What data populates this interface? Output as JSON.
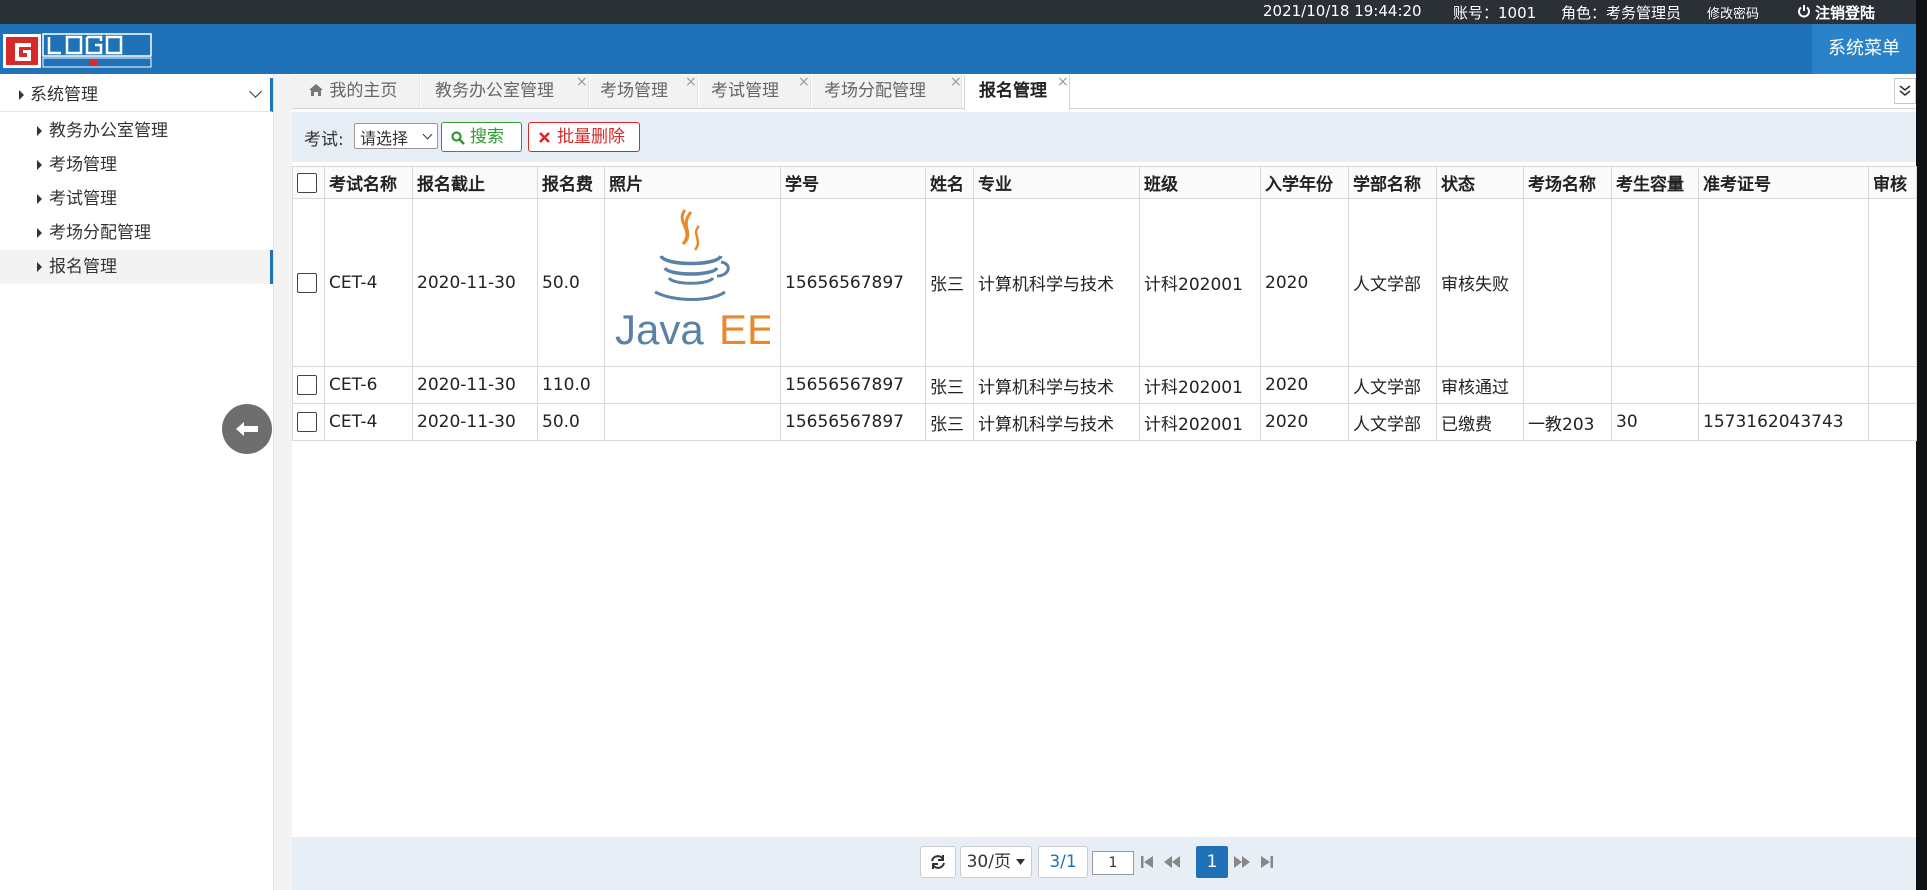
{
  "topbar": {
    "datetime": "2021/10/18 19:44:20",
    "account": "账号：1001",
    "role": "角色：考务管理员",
    "change_password": "修改密码",
    "logout": "注销登陆"
  },
  "header": {
    "system_menu": "系统菜单"
  },
  "sidebar": {
    "parent": "系统管理",
    "items": [
      "教务办公室管理",
      "考场管理",
      "考试管理",
      "考场分配管理",
      "报名管理"
    ]
  },
  "tabs": [
    {
      "label": "我的主页"
    },
    {
      "label": "教务办公室管理"
    },
    {
      "label": "考场管理"
    },
    {
      "label": "考试管理"
    },
    {
      "label": "考场分配管理"
    },
    {
      "label": "报名管理"
    }
  ],
  "toolbar": {
    "exam_label": "考试:",
    "exam_select": "请选择",
    "search_label": "搜索",
    "batch_delete_label": "批量删除"
  },
  "table": {
    "headers": [
      "考试名称",
      "报名截止",
      "报名费",
      "照片",
      "学号",
      "姓名",
      "专业",
      "班级",
      "入学年份",
      "学部名称",
      "状态",
      "考场名称",
      "考生容量",
      "准考证号",
      "审核"
    ],
    "rows": [
      [
        "CET-4",
        "2020-11-30",
        "50.0",
        "",
        "15656567897",
        "张三",
        "计算机科学与技术",
        "计科202001",
        "2020",
        "人文学部",
        "审核失败",
        "",
        "",
        "",
        ""
      ],
      [
        "CET-6",
        "2020-11-30",
        "110.0",
        "",
        "15656567897",
        "张三",
        "计算机科学与技术",
        "计科202001",
        "2020",
        "人文学部",
        "审核通过",
        "",
        "",
        "",
        ""
      ],
      [
        "CET-4",
        "2020-11-30",
        "50.0",
        "",
        "15656567897",
        "张三",
        "计算机科学与技术",
        "计科202001",
        "2020",
        "人文学部",
        "已缴费",
        "一教203",
        "30",
        "1573162043743",
        ""
      ]
    ],
    "photo_text_java": "Java",
    "photo_text_ee": "EE"
  },
  "pager": {
    "page_size": "30/页",
    "page_info": "3/1",
    "page_input": "1",
    "current_page": "1"
  },
  "colors": {
    "header_blue": "#1f72b8",
    "topbar_dark": "#2b3037",
    "search_green": "#2e9a32",
    "delete_red": "#d42a2a",
    "toolbar_bg": "#e7eef5"
  }
}
